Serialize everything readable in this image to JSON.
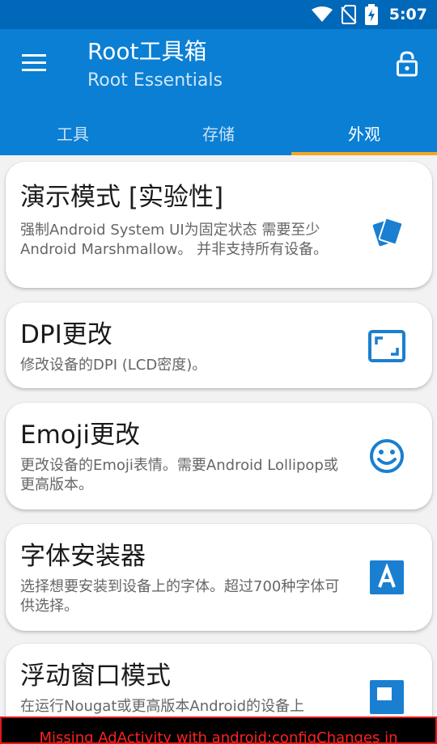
{
  "status_bar": {
    "time": "5:07",
    "icons": [
      "wifi-icon",
      "no-sim-icon",
      "battery-charging-icon"
    ]
  },
  "app_bar": {
    "title": "Root工具箱",
    "subtitle": "Root Essentials",
    "menu_icon": "menu-icon",
    "lock_icon": "lock-open-icon"
  },
  "tabs": [
    {
      "label": "工具",
      "active": false
    },
    {
      "label": "存储",
      "active": false
    },
    {
      "label": "外观",
      "active": true
    }
  ],
  "cards": [
    {
      "title": "演示模式 [实验性]",
      "desc": "强制Android System UI为固定状态 需要至少Android Marshmallow。 并非支持所有设备。",
      "icon": "cards-icon"
    },
    {
      "title": "DPI更改",
      "desc": "修改设备的DPI (LCD密度)。",
      "icon": "aspect-ratio-icon"
    },
    {
      "title": "Emoji更改",
      "desc": "更改设备的Emoji表情。需要Android Lollipop或更高版本。",
      "icon": "smiley-icon"
    },
    {
      "title": "字体安装器",
      "desc": "选择想要安装到设备上的字体。超过700种字体可供选择。",
      "icon": "font-icon"
    },
    {
      "title": "浮动窗口模式",
      "desc": "在运行Nougat或更高版本Android的设备上",
      "icon": "window-icon"
    }
  ],
  "error_banner": {
    "text": "Missing AdActivity with android:configChanges in"
  },
  "colors": {
    "primary": "#0a7fd4",
    "status_bar": "#0068b8",
    "accent": "#f5a623",
    "icon_blue": "#1a7fd0",
    "error": "#ff2020"
  }
}
